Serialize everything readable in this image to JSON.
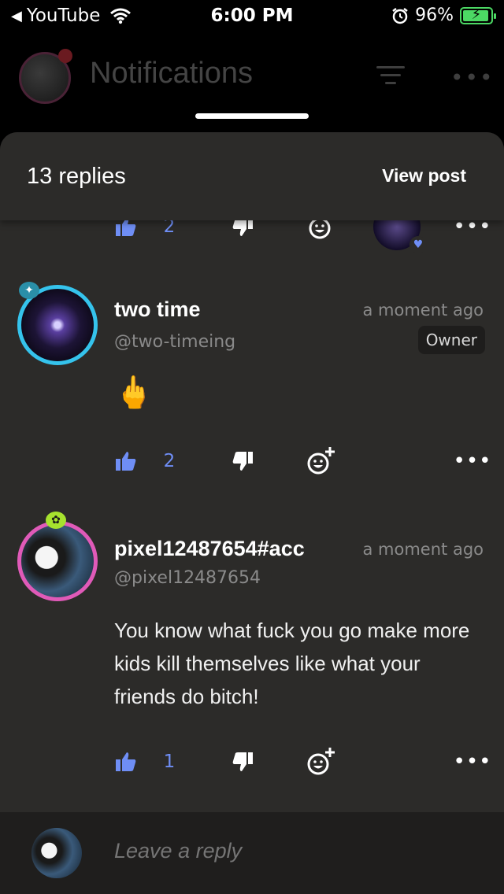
{
  "status_bar": {
    "back_app": "YouTube",
    "time": "6:00 PM",
    "battery": "96%",
    "battery_level": 0.96
  },
  "background_header": {
    "title": "Notifications"
  },
  "sheet": {
    "replies_count": "13 replies",
    "view_post": "View post"
  },
  "top_partial": {
    "like_count": "2"
  },
  "comments": [
    {
      "name": "two time",
      "handle": "@two-timeing",
      "time": "a moment ago",
      "badge": "Owner",
      "body": "🖕",
      "like_count": "2"
    },
    {
      "name": "pixel12487654#acc",
      "handle": "@pixel12487654",
      "time": "a moment ago",
      "body": "You know what fuck you go make more kids kill themselves like what your friends do bitch!",
      "like_count": "1"
    }
  ],
  "reply": {
    "placeholder": "Leave a reply"
  },
  "colors": {
    "sheet_bg": "#2c2b29",
    "accent_blue": "#6f8ef5",
    "battery_green": "#4cd964",
    "avatar_ring_1": "#35c3ec",
    "avatar_ring_2": "#e05ab8"
  },
  "icons": [
    "back-arrow-icon",
    "wifi-icon",
    "alarm-icon",
    "battery-icon",
    "filter-icon",
    "more-icon",
    "thumbs-up-icon",
    "thumbs-down-icon",
    "add-reaction-icon",
    "heart-icon"
  ]
}
